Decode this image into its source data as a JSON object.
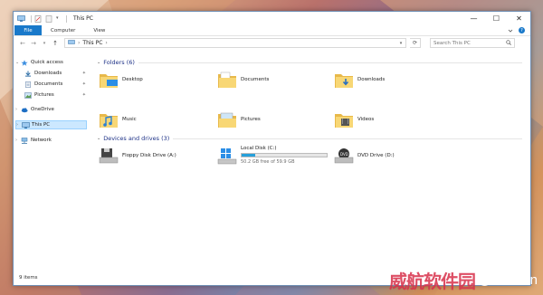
{
  "window": {
    "title": "This PC"
  },
  "ribbon": {
    "tabs": [
      "File",
      "Computer",
      "View"
    ]
  },
  "address": {
    "location": "This PC",
    "separator": "›"
  },
  "search": {
    "placeholder": "Search This PC"
  },
  "nav": {
    "quick_access": "Quick access",
    "downloads": "Downloads",
    "documents": "Documents",
    "pictures": "Pictures",
    "onedrive": "OneDrive",
    "this_pc": "This PC",
    "network": "Network"
  },
  "folders": {
    "header": "Folders (6)",
    "items": [
      "Desktop",
      "Documents",
      "Downloads",
      "Music",
      "Pictures",
      "Videos"
    ]
  },
  "drives": {
    "header": "Devices and drives (3)",
    "floppy": "Floppy Disk Drive (A:)",
    "local": {
      "name": "Local Disk (C:)",
      "free": "50.2 GB free of 59.9 GB",
      "used_fraction": 0.16
    },
    "dvd": "DVD Drive (D:)"
  },
  "status": {
    "items": "9 items"
  },
  "watermark": {
    "cn": "威航软件园",
    "brand": "Neowin"
  },
  "colors": {
    "accent": "#1979ca",
    "selection": "#cce8ff",
    "folder": "#f8d775"
  }
}
